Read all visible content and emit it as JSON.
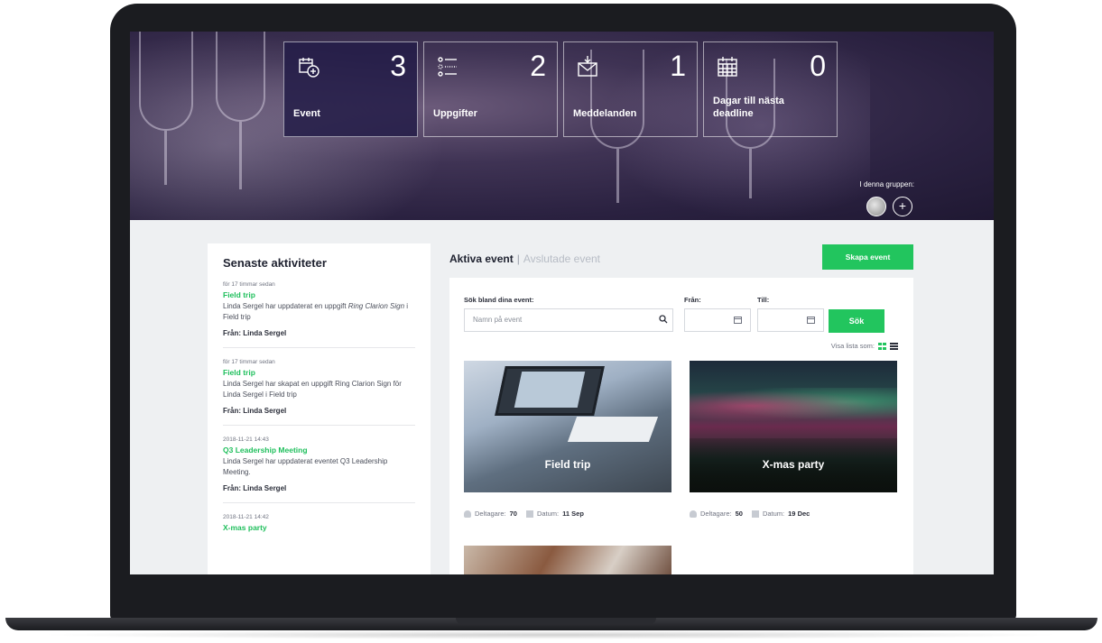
{
  "stats": [
    {
      "label": "Event",
      "count": "3",
      "icon": "calendar-add-icon"
    },
    {
      "label": "Uppgifter",
      "count": "2",
      "icon": "checklist-icon"
    },
    {
      "label": "Meddelanden",
      "count": "1",
      "icon": "envelope-icon"
    },
    {
      "label": "Dagar till nästa deadline",
      "count": "0",
      "icon": "calendar-grid-icon"
    }
  ],
  "group": {
    "label": "I denna gruppen:",
    "add": "+"
  },
  "sidebar": {
    "title": "Senaste aktiviteter",
    "items": [
      {
        "time": "för 17 timmar sedan",
        "link": "Field trip",
        "text_before": "Linda Sergel har uppdaterat en uppgift ",
        "text_em": "Ring Clarion Sign",
        "text_after": " i Field trip",
        "from": "Från: Linda Sergel"
      },
      {
        "time": "för 17 timmar sedan",
        "link": "Field trip",
        "text": "Linda Sergel har skapat en uppgift Ring Clarion Sign för Linda Sergel i Field trip",
        "from": "Från: Linda Sergel"
      },
      {
        "time": "2018-11-21 14:43",
        "link": "Q3 Leadership Meeting",
        "text": "Linda Sergel har uppdaterat eventet Q3 Leadership Meeting.",
        "from": "Från: Linda Sergel"
      },
      {
        "time": "2018-11-21 14:42",
        "link": "X-mas party"
      }
    ]
  },
  "tabs": {
    "active": "Aktiva event",
    "separator": "|",
    "inactive": "Avslutade event"
  },
  "create_button": "Skapa event",
  "search": {
    "label": "Sök bland dina event:",
    "placeholder": "Namn på event",
    "from_label": "Från:",
    "to_label": "Till:",
    "button": "Sök",
    "view_label": "Visa lista som:"
  },
  "events": [
    {
      "title": "Field trip",
      "participants_label": "Deltagare:",
      "participants": "70",
      "date_label": "Datum:",
      "date": "11 Sep"
    },
    {
      "title": "X-mas party",
      "participants_label": "Deltagare:",
      "participants": "50",
      "date_label": "Datum:",
      "date": "19 Dec"
    }
  ],
  "colors": {
    "accent": "#22c55e",
    "hero": "#2a2140",
    "active_stat": "#231c48"
  }
}
